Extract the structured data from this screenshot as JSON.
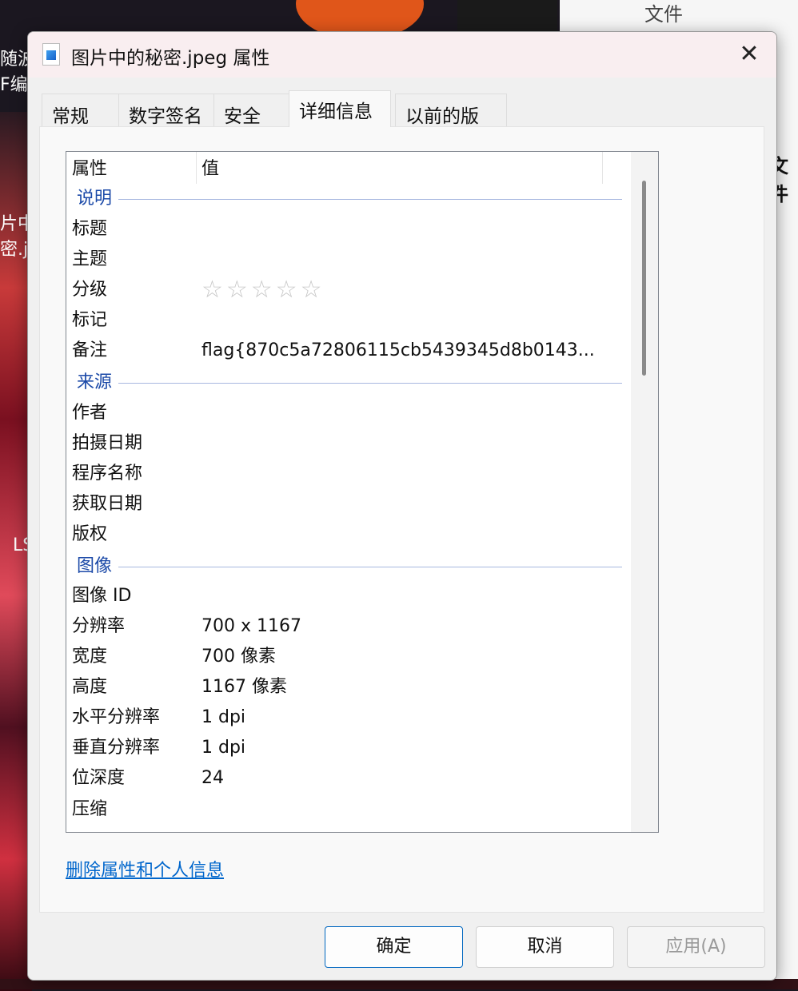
{
  "background": {
    "right_label": "文件",
    "right_label_2": "文件",
    "left_labels": [
      "随波",
      "F编",
      "片中",
      "密.j",
      "LS"
    ]
  },
  "dialog": {
    "title": "图片中的秘密.jpeg 属性",
    "tabs": [
      {
        "label": "常规",
        "active": false
      },
      {
        "label": "数字签名",
        "active": false
      },
      {
        "label": "安全",
        "active": false
      },
      {
        "label": "详细信息",
        "active": true
      },
      {
        "label": "以前的版本",
        "active": false
      }
    ],
    "list": {
      "header": {
        "property": "属性",
        "value": "值"
      },
      "groups": {
        "description": "说明",
        "origin": "来源",
        "image": "图像"
      },
      "rows": {
        "title": {
          "label": "标题",
          "value": ""
        },
        "subject": {
          "label": "主题",
          "value": ""
        },
        "rating": {
          "label": "分级",
          "stars": 0,
          "max": 5,
          "glyphs": "☆☆☆☆☆"
        },
        "tags": {
          "label": "标记",
          "value": ""
        },
        "comments": {
          "label": "备注",
          "value": "flag{870c5a72806115cb5439345d8b0143..."
        },
        "author": {
          "label": "作者",
          "value": ""
        },
        "date_taken": {
          "label": "拍摄日期",
          "value": ""
        },
        "program": {
          "label": "程序名称",
          "value": ""
        },
        "date_acquired": {
          "label": "获取日期",
          "value": ""
        },
        "copyright": {
          "label": "版权",
          "value": ""
        },
        "image_id": {
          "label": "图像 ID",
          "value": ""
        },
        "dimensions": {
          "label": "分辨率",
          "value": "700 x 1167"
        },
        "width": {
          "label": "宽度",
          "value": "700 像素"
        },
        "height": {
          "label": "高度",
          "value": "1167 像素"
        },
        "hres": {
          "label": "水平分辨率",
          "value": "1 dpi"
        },
        "vres": {
          "label": "垂直分辨率",
          "value": "1 dpi"
        },
        "bit_depth": {
          "label": "位深度",
          "value": "24"
        },
        "compression": {
          "label": "压缩",
          "value": ""
        }
      }
    },
    "remove_link": "删除属性和个人信息",
    "buttons": {
      "ok": "确定",
      "cancel": "取消",
      "apply": "应用(A)"
    }
  }
}
